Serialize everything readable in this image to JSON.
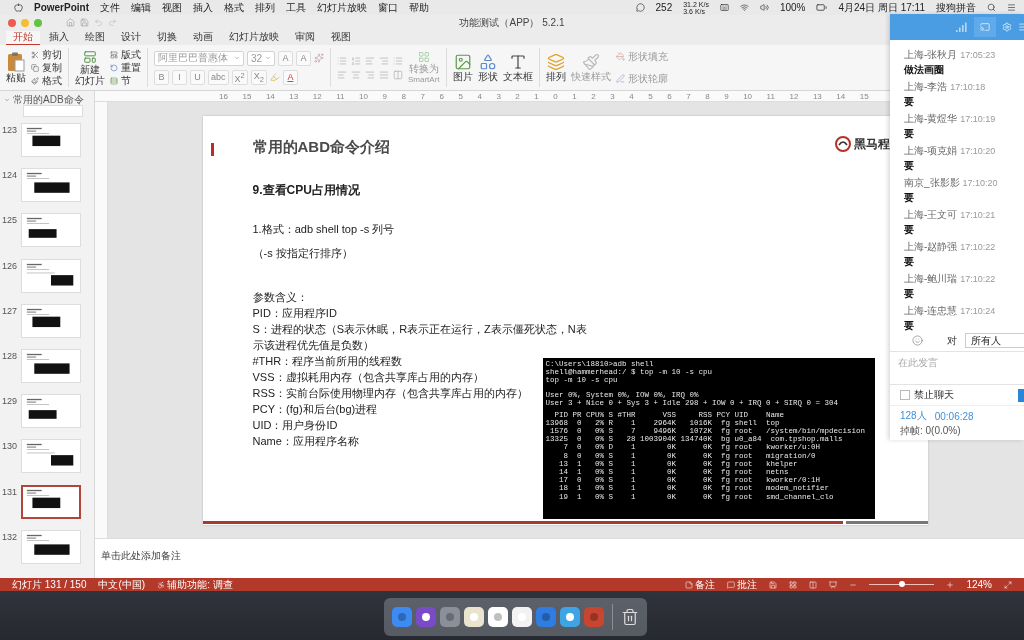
{
  "menubar": {
    "app": "PowerPoint",
    "menus": [
      "文件",
      "编辑",
      "视图",
      "插入",
      "格式",
      "排列",
      "工具",
      "幻灯片放映",
      "窗口",
      "帮助"
    ],
    "status": {
      "notifications": "252",
      "upload": "31.2 K/s",
      "download": "3.6 K/s",
      "battery": "100%",
      "datetime": "4月24日 周日 17:11",
      "input_method": "搜狗拼音"
    }
  },
  "window": {
    "title": "功能测试（APP） 5.2.1"
  },
  "ribbon_tabs": [
    {
      "label": "开始",
      "selected": true
    },
    {
      "label": "插入",
      "selected": false
    },
    {
      "label": "绘图",
      "selected": false
    },
    {
      "label": "设计",
      "selected": false
    },
    {
      "label": "切换",
      "selected": false
    },
    {
      "label": "动画",
      "selected": false
    },
    {
      "label": "幻灯片放映",
      "selected": false
    },
    {
      "label": "审阅",
      "selected": false
    },
    {
      "label": "视图",
      "selected": false
    }
  ],
  "ribbon": {
    "paste": "粘贴",
    "cut": "剪切",
    "copy": "复制",
    "format_painter": "格式",
    "new_slide": [
      "新建",
      "幻灯片"
    ],
    "layout": "版式",
    "reset": "重置",
    "section": "节",
    "font_name": "阿里巴巴普惠体",
    "font_size": "32",
    "grow_font": "A",
    "shrink_font": "A",
    "format_buttons": [
      "B",
      "I",
      "U",
      "abc",
      "X$^{2}$",
      "X$_{2}$"
    ],
    "font_color": "A",
    "convert_smartart": [
      "转换为",
      "SmartArt"
    ],
    "picture": "图片",
    "shapes": "形状",
    "textbox": "文本框",
    "arrange": "排列",
    "quick_styles": "快速样式",
    "shape_fill": "形状填充",
    "shape_outline": "形状轮廓"
  },
  "ruler_labels": [
    "16",
    "15",
    "14",
    "13",
    "12",
    "11",
    "10",
    "9",
    "8",
    "7",
    "6",
    "5",
    "4",
    "3",
    "2",
    "1",
    "0",
    "1",
    "2",
    "3",
    "4",
    "5",
    "6",
    "7",
    "8",
    "9",
    "10",
    "11",
    "12",
    "13",
    "14",
    "15"
  ],
  "thumbnails": {
    "section": "常用的ADB命令",
    "slides": [
      {
        "number": "123",
        "selected": false
      },
      {
        "number": "124",
        "selected": false
      },
      {
        "number": "125",
        "selected": false
      },
      {
        "number": "126",
        "selected": false
      },
      {
        "number": "127",
        "selected": false
      },
      {
        "number": "128",
        "selected": false
      },
      {
        "number": "129",
        "selected": false
      },
      {
        "number": "130",
        "selected": false
      },
      {
        "number": "131",
        "selected": true
      },
      {
        "number": "132",
        "selected": false
      }
    ]
  },
  "slide": {
    "title": "常用的ABD命令介绍",
    "logo": "黑马程",
    "heading": "9.查看CPU占用情况",
    "format": "1.格式：adb shell top -s 列号",
    "format_note": "（-s 按指定行排序）",
    "params_title": "参数含义：",
    "params": [
      "PID：应用程序ID",
      "S：进程的状态（S表示休眠，R表示正在运行，Z表示僵死状态，N表示该进程优先值是负数）",
      "#THR：程序当前所用的线程数",
      "VSS：虚拟耗用内存（包含共享库占用的内存）",
      "RSS：实前台际使用物理内存（包含共享库占用的内存）",
      "PCY：(fg)和后台(bg)进程",
      "UID：用户身份ID",
      "Name：应用程序名称"
    ],
    "terminal": [
      [
        "C:\\Users\\18810>adb shell",
        "shell@hammerhead:/ $ top -m 10 -s cpu",
        "top -m 10 -s cpu"
      ],
      [
        "User 0%, System 0%, IOW 0%, IRQ 0%",
        "User 3 + Nice 0 + Sys 3 + Idle 298 + IOW 0 + IRQ 0 + SIRQ 0 = 304"
      ],
      [
        "  PID PR CPU% S #THR      VSS     RSS PCY UID    Name",
        "13968  0   2% R    1    2964K   1016K  fg shell  top",
        " 1576  0   0% S    7    9496K   1072K  fg root   /system/bin/mpdecision",
        "13325  0   0% S   28 1003904K 134740K  bg u0_a84  com.tpshop.malls",
        "    7  0   0% D    1       0K      0K  fg root   kworker/u:0H",
        "    8  0   0% S    1       0K      0K  fg root   migration/0",
        "   13  1   0% S    1       0K      0K  fg root   khelper",
        "   14  1   0% S    1       0K      0K  fg root   netns",
        "   17  0   0% S    1       0K      0K  fg root   kworker/0:1H",
        "   18  1   0% S    1       0K      0K  fg root   modem_notifier",
        "   19  1   0% S    1       0K      0K  fg root   smd_channel_clo"
      ]
    ]
  },
  "notes": {
    "placeholder": "单击此处添加备注"
  },
  "chat": {
    "messages": [
      {
        "sender": "上海-张秋月",
        "time": "17:05:23",
        "text": "做法画圈"
      },
      {
        "sender": "上海-李浩",
        "time": "17:10:18",
        "text": "要"
      },
      {
        "sender": "上海-黄煜华",
        "time": "17:10:19",
        "text": "要"
      },
      {
        "sender": "上海-项克娟",
        "time": "17:10:20",
        "text": "要"
      },
      {
        "sender": "南京_张影影",
        "time": "17:10:20",
        "text": "要"
      },
      {
        "sender": "上海-王文可",
        "time": "17:10:21",
        "text": "要"
      },
      {
        "sender": "上海-赵静强",
        "time": "17:10:22",
        "text": "要"
      },
      {
        "sender": "上海-鲍川瑞",
        "time": "17:10:22",
        "text": "要"
      },
      {
        "sender": "上海-连忠慧",
        "time": "17:10:24",
        "text": "要"
      }
    ],
    "to_label": "对",
    "recipient": "所有人",
    "input_placeholder": "在此发言",
    "mute": {
      "label": "禁止聊天",
      "checked": false
    },
    "online": "128人",
    "duration": "00:06:28",
    "dropped_frames": "掉帧: 0(0.0%)"
  },
  "status_bar": {
    "slide": "幻灯片 131 / 150",
    "language": "中文(中国)",
    "accessibility": "辅助功能: 调查",
    "notes": "备注",
    "comments": "批注",
    "zoom": {
      "level": 0.5
    },
    "zoom_percent": "124%"
  }
}
